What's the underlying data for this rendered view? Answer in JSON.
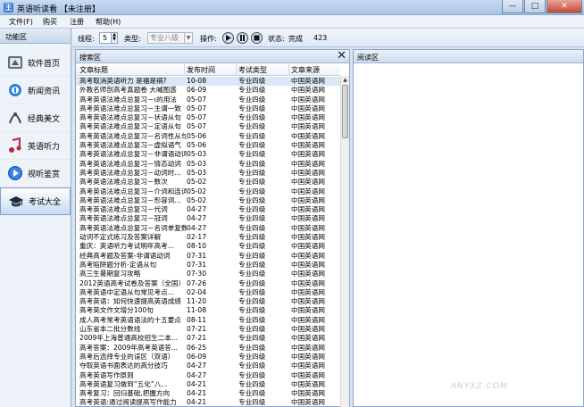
{
  "window": {
    "icon_text": "王",
    "title": "英语听读看 【未注册】",
    "minimize": "—",
    "maximize": "□",
    "close": "✕"
  },
  "menu": [
    {
      "label": "文件(F)"
    },
    {
      "label": "购买"
    },
    {
      "label": "注册"
    },
    {
      "label": "帮助(H)"
    }
  ],
  "sidebar": {
    "title": "功能区",
    "items": [
      {
        "label": "软件首页",
        "icon": "home-icon",
        "active": false
      },
      {
        "label": "新闻资讯",
        "icon": "news-icon",
        "active": false
      },
      {
        "label": "经典美文",
        "icon": "article-icon",
        "active": false
      },
      {
        "label": "英语听力",
        "icon": "music-icon",
        "active": false
      },
      {
        "label": "视听鉴赏",
        "icon": "play-icon",
        "active": false
      },
      {
        "label": "考试大全",
        "icon": "graduation-cap-icon",
        "active": true
      }
    ]
  },
  "toolbar": {
    "threads_label": "线程:",
    "threads_value": "5",
    "type_label": "类型:",
    "type_value": "专业八级",
    "ops_label": "操作:",
    "status_label": "状态:",
    "status_value": "完成",
    "count": "423"
  },
  "list_panel": {
    "title": "搜索区",
    "close_glyph": "✕",
    "columns": [
      "文章标题",
      "发布时间",
      "考试类型",
      "文章来源"
    ],
    "rows": [
      [
        "高考取消英语听力 是福是祸?",
        "10-08",
        "专业四级",
        "中国英语网"
      ],
      [
        "外教名师剖高考真题卷 大喊图惑",
        "06-09",
        "专业四级",
        "中国英语网"
      ],
      [
        "高考英语法难点总复习－ι的用法",
        "05-07",
        "专业四级",
        "中国英语网"
      ],
      [
        "高考英语法难点总复习－主谓一致",
        "05-07",
        "专业四级",
        "中国英语网"
      ],
      [
        "高考英语法难点总复习－状语从句",
        "05-07",
        "专业四级",
        "中国英语网"
      ],
      [
        "高考英语法难点总复习－定语从句",
        "05-07",
        "专业四级",
        "中国英语网"
      ],
      [
        "高考英语法难点总复习－名词性从句",
        "05-06",
        "专业四级",
        "中国英语网"
      ],
      [
        "高考英语法难点总复习－虚拟语气",
        "05-06",
        "专业四级",
        "中国英语网"
      ],
      [
        "高考英语法难点总复习－非谓语动词",
        "05-03",
        "专业四级",
        "中国英语网"
      ],
      [
        "高考英语法难点总复习－情态动词",
        "05-03",
        "专业四级",
        "中国英语网"
      ],
      [
        "高考英语法难点总复习－动词时...",
        "05-03",
        "专业四级",
        "中国英语网"
      ],
      [
        "高考英语法难点总复习－数次",
        "05-02",
        "专业四级",
        "中国英语网"
      ],
      [
        "高考英语法难点总复习－介词和连词",
        "05-02",
        "专业四级",
        "中国英语网"
      ],
      [
        "高考英语法难点总复习－形容词...",
        "05-02",
        "专业四级",
        "中国英语网"
      ],
      [
        "高考英语法难点总复习－代词",
        "04-27",
        "专业四级",
        "中国英语网"
      ],
      [
        "高考英语法难点总复习－冠词",
        "04-27",
        "专业四级",
        "中国英语网"
      ],
      [
        "高考英语法难点总复习－名词单复数",
        "04-27",
        "专业四级",
        "中国英语网"
      ],
      [
        "动词不定式练习及答案详解",
        "02-17",
        "专业四级",
        "中国英语网"
      ],
      [
        "重庆：英语听力考试明年高考...",
        "08-10",
        "专业四级",
        "中国英语网"
      ],
      [
        "经典高考题及答案-非谓语动词",
        "07-31",
        "专业四级",
        "中国英语网"
      ],
      [
        "高考陷阱题分析-定语从句",
        "07-31",
        "专业四级",
        "中国英语网"
      ],
      [
        "高三生暑期复习攻略",
        "07-30",
        "专业四级",
        "中国英语网"
      ],
      [
        "2012英语高考试卷及答案（全国）",
        "07-26",
        "专业四级",
        "中国英语网"
      ],
      [
        "高考英语中定语从句常见考点...",
        "02-04",
        "专业四级",
        "中国英语网"
      ],
      [
        "高考英语：如何快速提高英语成绩",
        "11-20",
        "专业四级",
        "中国英语网"
      ],
      [
        "高考英文作文增分100句",
        "11-08",
        "专业四级",
        "中国英语网"
      ],
      [
        "成人高考常考英语语法的十五要点",
        "08-11",
        "专业四级",
        "中国英语网"
      ],
      [
        "山东省本二批分数线",
        "07-21",
        "专业四级",
        "中国英语网"
      ],
      [
        "2009年上海普通高校招生二本...",
        "07-21",
        "专业四级",
        "中国英语网"
      ],
      [
        "高考答案：2009年高考英语答...",
        "06-25",
        "专业四级",
        "中国英语网"
      ],
      [
        "高考后选择专业的误区（双语）",
        "06-09",
        "专业四级",
        "中国英语网"
      ],
      [
        "夺取英语书面表达的高分技巧",
        "04-27",
        "专业四级",
        "中国英语网"
      ],
      [
        "高考英语写作原则",
        "04-27",
        "专业四级",
        "中国英语网"
      ],
      [
        "高考英语复习做到“五化”八...",
        "04-21",
        "专业四级",
        "中国英语网"
      ],
      [
        "高考复习：回归基础,把握方向",
        "04-21",
        "专业四级",
        "中国英语网"
      ],
      [
        "高考英语:通过阅读提高写作能力",
        "04-21",
        "专业四级",
        "中国英语网"
      ]
    ]
  },
  "read_panel": {
    "title": "阅读区"
  },
  "watermark": "ANYXZ.COM"
}
